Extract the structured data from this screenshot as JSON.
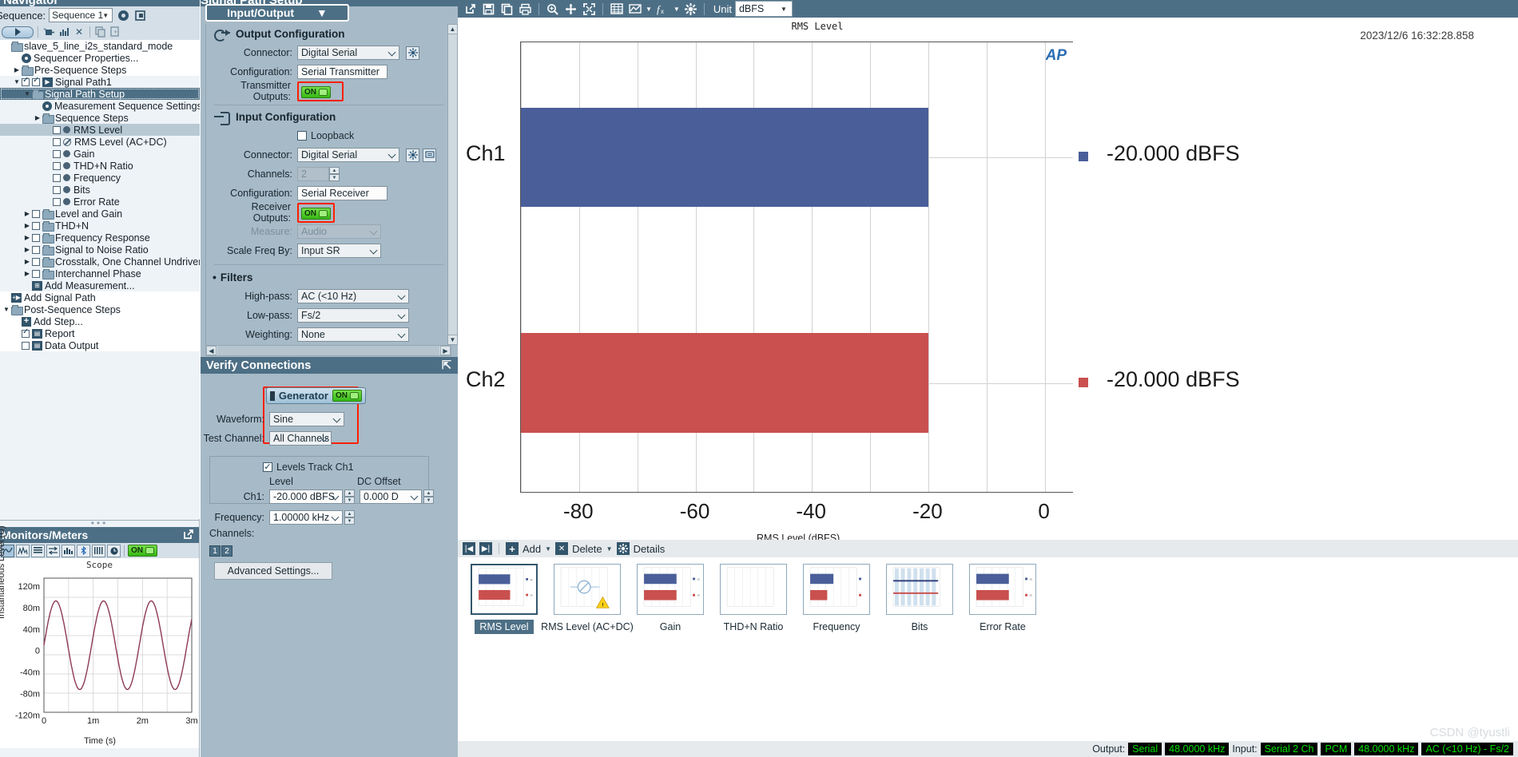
{
  "navigator": {
    "title": "Navigator",
    "sequence_label": "Sequence:",
    "sequence_value": "Sequence 1",
    "tree": [
      {
        "label": "slave_5_line_i2s_standard_mode",
        "indent": 0,
        "kind": "root",
        "state": "white"
      },
      {
        "label": "Sequencer Properties...",
        "indent": 1,
        "kind": "gear",
        "state": "white"
      },
      {
        "label": "Pre-Sequence Steps",
        "indent": 1,
        "kind": "folder",
        "arrow": "▶",
        "state": "white"
      },
      {
        "label": "Signal Path1",
        "indent": 1,
        "kind": "signalpath",
        "arrow": "▼",
        "checked": true,
        "state": "light"
      },
      {
        "label": "Signal Path Setup",
        "indent": 2,
        "kind": "folder",
        "arrow": "▼",
        "checked": true,
        "state": "selected"
      },
      {
        "label": "Measurement Sequence Settings...",
        "indent": 3,
        "kind": "gear",
        "state": "light"
      },
      {
        "label": "Sequence Steps",
        "indent": 3,
        "kind": "folder",
        "arrow": "▶",
        "state": "light"
      },
      {
        "label": "RMS Level",
        "indent": 4,
        "kind": "dot",
        "checkbox": true,
        "state": "row-selected"
      },
      {
        "label": "RMS Level (AC+DC)",
        "indent": 4,
        "kind": "nodot",
        "checkbox": true,
        "state": "light"
      },
      {
        "label": "Gain",
        "indent": 4,
        "kind": "dot",
        "checkbox": true,
        "state": "light"
      },
      {
        "label": "THD+N Ratio",
        "indent": 4,
        "kind": "dot",
        "checkbox": true,
        "state": "light"
      },
      {
        "label": "Frequency",
        "indent": 4,
        "kind": "dot",
        "checkbox": true,
        "state": "light"
      },
      {
        "label": "Bits",
        "indent": 4,
        "kind": "dot",
        "checkbox": true,
        "state": "light"
      },
      {
        "label": "Error Rate",
        "indent": 4,
        "kind": "dot",
        "checkbox": true,
        "state": "light"
      },
      {
        "label": "Level and Gain",
        "indent": 2,
        "kind": "folder",
        "arrow": "▶",
        "checkbox": true,
        "state": "light"
      },
      {
        "label": "THD+N",
        "indent": 2,
        "kind": "folder",
        "arrow": "▶",
        "checkbox": true,
        "state": "light"
      },
      {
        "label": "Frequency Response",
        "indent": 2,
        "kind": "folder",
        "arrow": "▶",
        "checkbox": true,
        "state": "light"
      },
      {
        "label": "Signal to Noise Ratio",
        "indent": 2,
        "kind": "folder",
        "arrow": "▶",
        "checkbox": true,
        "state": "light"
      },
      {
        "label": "Crosstalk, One Channel Undriven",
        "indent": 2,
        "kind": "folder",
        "arrow": "▶",
        "checkbox": true,
        "state": "light"
      },
      {
        "label": "Interchannel Phase",
        "indent": 2,
        "kind": "folder",
        "arrow": "▶",
        "checkbox": true,
        "state": "light"
      },
      {
        "label": "Add Measurement...",
        "indent": 2,
        "kind": "addmeas",
        "state": "light"
      },
      {
        "label": "Add Signal Path",
        "indent": 0,
        "kind": "addpath",
        "state": "white"
      },
      {
        "label": "Post-Sequence Steps",
        "indent": 0,
        "kind": "folder",
        "arrow": "▼",
        "state": "white"
      },
      {
        "label": "Add Step...",
        "indent": 1,
        "kind": "plus",
        "state": "white"
      },
      {
        "label": "Report",
        "indent": 1,
        "kind": "report",
        "checkbox": true,
        "checked": true,
        "state": "white"
      },
      {
        "label": "Data Output",
        "indent": 1,
        "kind": "dataout",
        "checkbox": true,
        "state": "white"
      }
    ]
  },
  "monitors": {
    "title": "Monitors/Meters",
    "power_label": "ON",
    "toolbar_icons": [
      "scope-icon",
      "fft-icon",
      "meter-list-icon",
      "transfer-icon",
      "bargraph-icon",
      "bluetooth-icon",
      "bits-icon",
      "clock-icon"
    ],
    "scope": {
      "title": "Scope",
      "ylabel": "Instantaneous Level (U)",
      "xlabel": "Time (s)",
      "yticks": [
        "120m",
        "80m",
        "40m",
        "0",
        "-40m",
        "-80m",
        "-120m"
      ],
      "xticks": [
        "0",
        "1m",
        "2m",
        "3m"
      ],
      "trace_color": "#8d3a52"
    }
  },
  "center": {
    "panel_title": "Signal Path Setup",
    "tab_label": "Input/Output",
    "output_section": {
      "heading": "Output Configuration",
      "rows": [
        {
          "label": "Connector:",
          "value": "Digital Serial",
          "type": "combo"
        },
        {
          "label": "Configuration:",
          "value": "Serial Transmitter",
          "type": "text"
        },
        {
          "label": "Transmitter Outputs:",
          "value": "ON",
          "type": "toggle",
          "highlighted": true
        }
      ]
    },
    "input_section": {
      "heading": "Input Configuration",
      "loopback_label": "Loopback",
      "loopback_checked": false,
      "rows": [
        {
          "label": "Connector:",
          "value": "Digital Serial",
          "type": "combo"
        },
        {
          "label": "Channels:",
          "value": "2",
          "type": "spin",
          "disabled": true
        },
        {
          "label": "Configuration:",
          "value": "Serial Receiver",
          "type": "text"
        },
        {
          "label": "Receiver Outputs:",
          "value": "ON",
          "type": "toggle",
          "highlighted": true
        },
        {
          "label": "Measure:",
          "value": "Audio",
          "type": "combo",
          "disabled": true
        },
        {
          "label": "Scale Freq By:",
          "value": "Input SR",
          "type": "combo"
        }
      ]
    },
    "filters_section": {
      "heading": "Filters",
      "rows": [
        {
          "label": "High-pass:",
          "value": "AC (<10 Hz)"
        },
        {
          "label": "Low-pass:",
          "value": "Fs/2"
        },
        {
          "label": "Weighting:",
          "value": "None"
        }
      ]
    },
    "verify": {
      "title": "Verify Connections",
      "generator_label": "Generator",
      "generator_state": "ON",
      "rows": [
        {
          "label": "Waveform:",
          "value": "Sine"
        },
        {
          "label": "Test Channel:",
          "value": "All Channels"
        }
      ],
      "levels_track_label": "Levels Track Ch1",
      "levels_track_checked": true,
      "level_col": "Level",
      "dc_offset_col": "DC Offset",
      "ch1_label": "Ch1:",
      "ch1_level": "-20.000 dBFS",
      "ch1_dc_offset": "0.000 D",
      "frequency_label": "Frequency:",
      "frequency_value": "1.00000 kHz",
      "channels_label": "Channels:",
      "channel_buttons": [
        "1",
        "2"
      ],
      "advanced_button": "Advanced Settings..."
    }
  },
  "graph": {
    "toolbar": {
      "icons": [
        "popout-icon",
        "save-icon",
        "copy-icon",
        "print-icon",
        "zoom-icon",
        "pan-icon",
        "fit-icon",
        "table-icon",
        "graph-icon",
        "function-icon",
        "settings-icon"
      ],
      "unit_label": "Unit",
      "unit_value": "dBFS"
    },
    "timestamp": "2023/12/6 16:32:28.858",
    "ap_logo": "AP",
    "measure_toolbar": {
      "first_label": "",
      "add_label": "Add",
      "delete_label": "Delete",
      "details_label": "Details"
    },
    "thumbnails": [
      {
        "label": "RMS Level",
        "selected": true,
        "kind": "bars"
      },
      {
        "label": "RMS Level (AC+DC)",
        "selected": false,
        "kind": "nodata"
      },
      {
        "label": "Gain",
        "selected": false,
        "kind": "bars"
      },
      {
        "label": "THD+N Ratio",
        "selected": false,
        "kind": "empty"
      },
      {
        "label": "Frequency",
        "selected": false,
        "kind": "bars-short"
      },
      {
        "label": "Bits",
        "selected": false,
        "kind": "bits"
      },
      {
        "label": "Error Rate",
        "selected": false,
        "kind": "bars"
      }
    ],
    "statusbar": {
      "output_label": "Output:",
      "output_chips": [
        "Serial",
        "48.0000 kHz"
      ],
      "input_label": "Input:",
      "input_chips": [
        "Serial 2 Ch",
        "PCM",
        "48.0000 kHz",
        "AC (<10 Hz) - Fs/2"
      ]
    },
    "watermark": "CSDN @tyustli"
  },
  "chart_data": {
    "type": "bar",
    "title": "RMS Level",
    "xlabel": "RMS Level (dBFS)",
    "ylabel": "",
    "orientation": "horizontal",
    "categories": [
      "Ch1",
      "Ch2"
    ],
    "values": [
      -20.0,
      -20.0
    ],
    "value_labels": [
      "-20.000 dBFS",
      "-20.000 dBFS"
    ],
    "colors": [
      "#4a5e99",
      "#c9504e"
    ],
    "xlim": [
      -90,
      5
    ],
    "xticks": [
      -80,
      -60,
      -40,
      -20,
      0
    ],
    "xtick_labels": [
      "-80",
      "-60",
      "-40",
      "-20",
      "0"
    ],
    "grid": true,
    "legend": "right-values"
  }
}
